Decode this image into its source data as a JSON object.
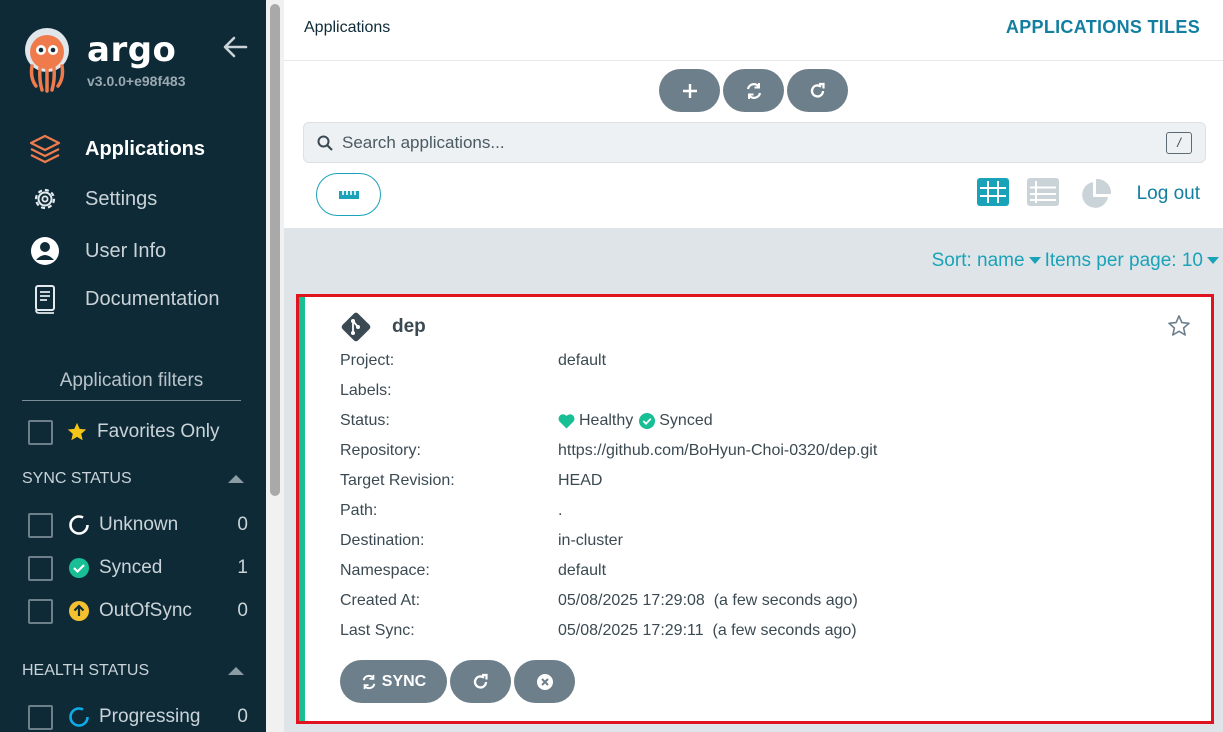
{
  "sidebar": {
    "brand": "argo",
    "version": "v3.0.0+e98f483",
    "nav": [
      {
        "label": "Applications",
        "icon": "layers-icon"
      },
      {
        "label": "Settings",
        "icon": "gear-icon"
      },
      {
        "label": "User Info",
        "icon": "user-circle-icon"
      },
      {
        "label": "Documentation",
        "icon": "book-icon"
      }
    ],
    "filters_title": "Application filters",
    "favorites_label": "Favorites Only",
    "sync_status": {
      "title": "SYNC STATUS",
      "items": [
        {
          "label": "Unknown",
          "count": "0",
          "icon": "circle-notch-icon"
        },
        {
          "label": "Synced",
          "count": "1",
          "icon": "check-circle-icon"
        },
        {
          "label": "OutOfSync",
          "count": "0",
          "icon": "arrow-up-circle-icon"
        }
      ]
    },
    "health_status": {
      "title": "HEALTH STATUS",
      "items": [
        {
          "label": "Progressing",
          "count": "0",
          "icon": "spinner-icon"
        }
      ]
    }
  },
  "header": {
    "breadcrumb": "Applications",
    "view_title": "APPLICATIONS TILES"
  },
  "search": {
    "placeholder": "Search applications...",
    "shortcut": "/"
  },
  "logout_label": "Log out",
  "sort": {
    "label": "Sort: name",
    "items_per_page": "Items per page: 10"
  },
  "app": {
    "name": "dep",
    "fields": [
      {
        "key": "Project:",
        "value": "default"
      },
      {
        "key": "Labels:",
        "value": ""
      },
      {
        "key": "Status:",
        "value": ""
      },
      {
        "key": "Repository:",
        "value": "https://github.com/BoHyun-Choi-0320/dep.git"
      },
      {
        "key": "Target Revision:",
        "value": "HEAD"
      },
      {
        "key": "Path:",
        "value": "."
      },
      {
        "key": "Destination:",
        "value": "in-cluster"
      },
      {
        "key": "Namespace:",
        "value": "default"
      },
      {
        "key": "Created At:",
        "value": "05/08/2025 17:29:08  (a few seconds ago)"
      },
      {
        "key": "Last Sync:",
        "value": "05/08/2025 17:29:11  (a few seconds ago)"
      }
    ],
    "health": "Healthy",
    "sync": "Synced",
    "sync_button": "SYNC"
  },
  "colors": {
    "sidebar_bg": "#0e2a37",
    "accent": "#1aa3b8",
    "healthy": "#18be94",
    "highlight": "#e0141e"
  }
}
